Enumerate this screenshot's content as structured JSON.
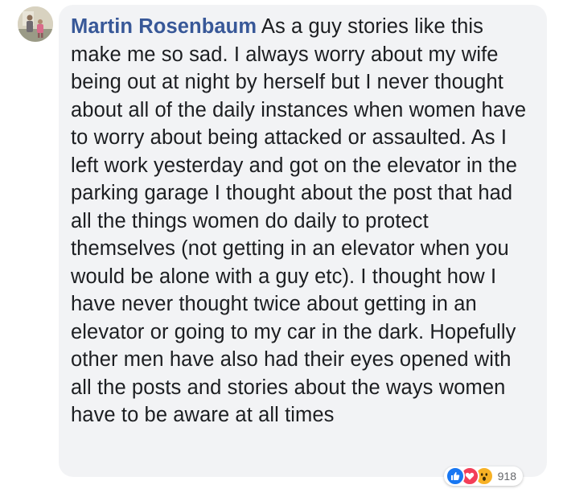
{
  "comment": {
    "author": "Martin Rosenbaum",
    "body": "As a guy stories like this make me so sad. I always worry about my wife being out at night by herself but I never thought about all of the daily instances when women have to worry about being attacked or assaulted. As I left work yesterday and got on the elevator in the parking garage I thought about the post that had all the things women do daily to protect themselves (not getting in an elevator when you would be alone with a guy etc). I thought how I have never thought twice about getting in an elevator or going to my car in the dark. Hopefully other men have also had their eyes opened with all the posts and stories about the ways women have to be aware at all times",
    "reactions": {
      "types": [
        "like-icon",
        "love-icon",
        "wow-icon"
      ],
      "count": "918"
    }
  },
  "colors": {
    "author_link": "#385898",
    "bubble_bg": "#f2f3f5",
    "text": "#1c1e21",
    "like": "#1877f2",
    "love": "#f33e58",
    "wow": "#f7b125"
  }
}
